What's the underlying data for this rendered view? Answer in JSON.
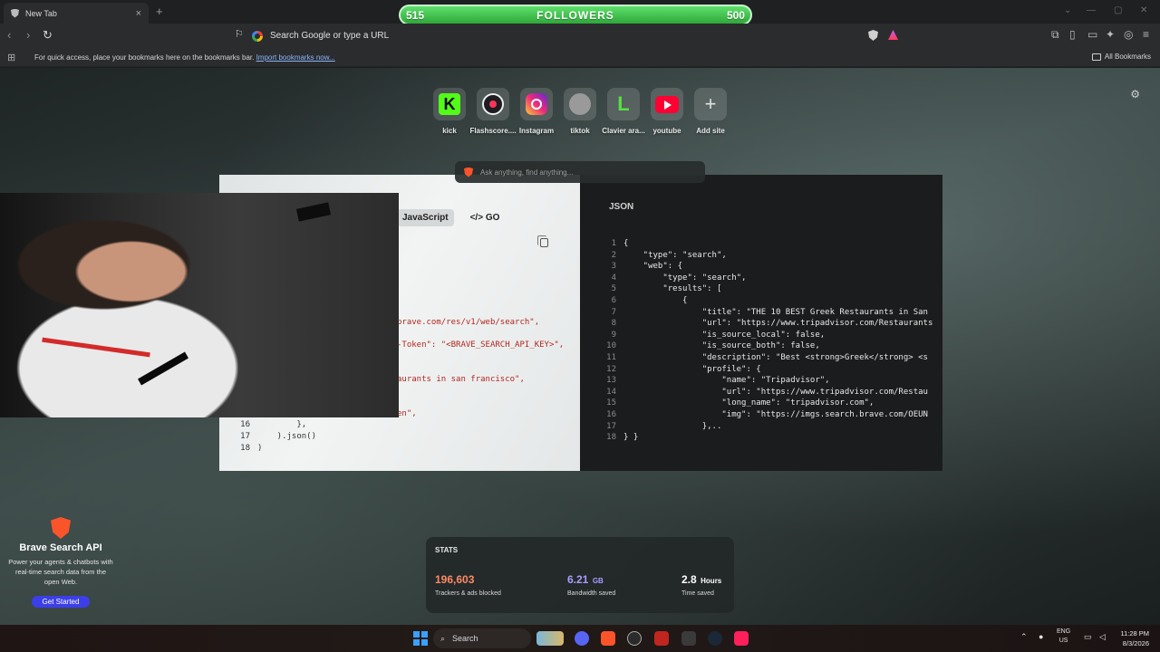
{
  "browser": {
    "tab_title": "New Tab",
    "url_placeholder": "Search Google or type a URL"
  },
  "followers": {
    "current": "515",
    "label": "FOLLOWERS",
    "goal": "500"
  },
  "bookmarks_bar": {
    "text": "For quick access, place your bookmarks here on the bookmarks bar.",
    "import_link": "Import bookmarks now...",
    "all_bookmarks": "All Bookmarks"
  },
  "top_sites": [
    {
      "label": "kick",
      "icon": "kick-icon"
    },
    {
      "label": "Flashscore....",
      "icon": "flashscore-icon"
    },
    {
      "label": "Instagram",
      "icon": "instagram-icon"
    },
    {
      "label": "tiktok",
      "icon": "tiktok-icon"
    },
    {
      "label": "Clavier ara...",
      "icon": "clavier-icon"
    },
    {
      "label": "youtube",
      "icon": "youtube-icon"
    },
    {
      "label": "Add site",
      "icon": "plus-icon"
    }
  ],
  "ai_search": {
    "placeholder": "Ask anything, find anything..."
  },
  "code_widget": {
    "tabs": [
      "JavaScript",
      "GO"
    ],
    "lines": [
      {
        "text": "brave.com/res/v1/web/search\","
      },
      {
        "text": "-Token\": \"<BRAVE_SEARCH_API_KEY>\","
      },
      {
        "text": "aurants in san francisco\","
      },
      {
        "text": "en\","
      },
      {
        "num": "16",
        "text": "        },"
      },
      {
        "num": "17",
        "text": "    ).json()"
      },
      {
        "num": "18",
        "text": ")"
      }
    ]
  },
  "json_widget": {
    "title": "JSON",
    "lines": [
      {
        "num": "1",
        "text": "{"
      },
      {
        "num": "2",
        "text": "    \"type\": \"search\","
      },
      {
        "num": "3",
        "text": "    \"web\": {"
      },
      {
        "num": "4",
        "text": "        \"type\": \"search\","
      },
      {
        "num": "5",
        "text": "        \"results\": ["
      },
      {
        "num": "6",
        "text": "            {"
      },
      {
        "num": "7",
        "text": "                \"title\": \"THE 10 BEST Greek Restaurants in San"
      },
      {
        "num": "8",
        "text": "                \"url\": \"https://www.tripadvisor.com/Restaurants"
      },
      {
        "num": "9",
        "text": "                \"is_source_local\": false,"
      },
      {
        "num": "10",
        "text": "                \"is_source_both\": false,"
      },
      {
        "num": "11",
        "text": "                \"description\": \"Best <strong>Greek</strong> <s"
      },
      {
        "num": "12",
        "text": "                \"profile\": {"
      },
      {
        "num": "13",
        "text": "                    \"name\": \"Tripadvisor\","
      },
      {
        "num": "14",
        "text": "                    \"url\": \"https://www.tripadvisor.com/Restau"
      },
      {
        "num": "15",
        "text": "                    \"long_name\": \"tripadvisor.com\","
      },
      {
        "num": "16",
        "text": "                    \"img\": \"https://imgs.search.brave.com/OEUN"
      },
      {
        "num": "17",
        "text": "                },.."
      },
      {
        "num": "18",
        "text": "} }"
      }
    ]
  },
  "promo": {
    "title": "Brave Search API",
    "description": "Power your agents & chatbots with real-time search data from the open Web.",
    "button": "Get Started"
  },
  "stats": {
    "title": "STATS",
    "items": [
      {
        "value": "196,603",
        "unit": "",
        "label": "Trackers & ads blocked",
        "color": "#ff8a65"
      },
      {
        "value": "6.21",
        "unit": "GB",
        "label": "Bandwidth saved",
        "color": "#a99cff"
      },
      {
        "value": "2.8",
        "unit": "Hours",
        "label": "Time saved",
        "color": "#ffffff"
      }
    ]
  },
  "taskbar": {
    "search_label": "Search",
    "lang_line1": "ENG",
    "lang_line2": "US",
    "time": "11:28 PM",
    "date": "8/3/2026"
  }
}
